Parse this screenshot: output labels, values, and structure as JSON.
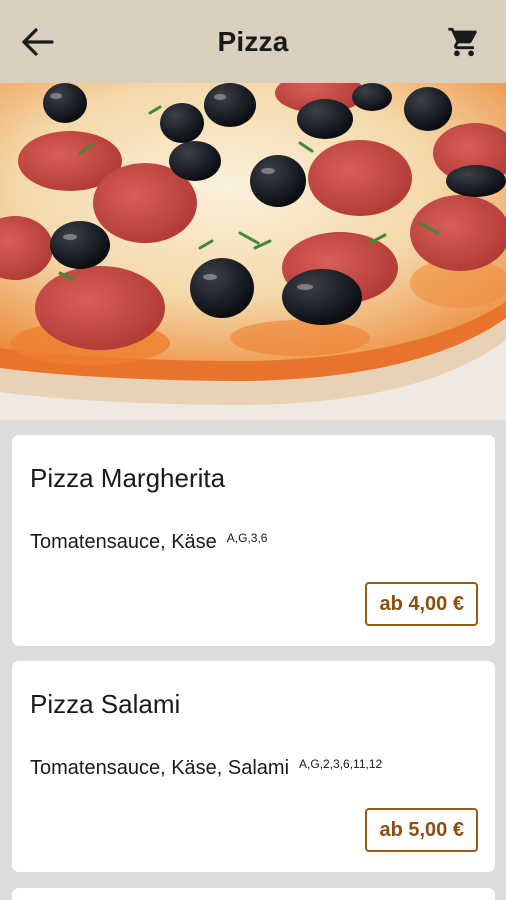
{
  "header": {
    "title": "Pizza",
    "back_icon": "arrow-left-icon",
    "cart_icon": "shopping-cart-icon",
    "background_color": "#d9cfbe"
  },
  "hero": {
    "image_subject": "pepperoni pizza with black olives"
  },
  "products": [
    {
      "name": "Pizza Margherita",
      "description": "Tomatensauce, Käse",
      "allergens": "A,G,3,6",
      "price": "ab 4,00 €"
    },
    {
      "name": "Pizza Salami",
      "description": "Tomatensauce, Käse, Salami",
      "allergens": "A,G,2,3,6,11,12",
      "price": "ab 5,00 €"
    }
  ],
  "colors": {
    "accent": "#8a4f0e",
    "page_background": "#dcdcdc",
    "card_background": "#ffffff"
  }
}
